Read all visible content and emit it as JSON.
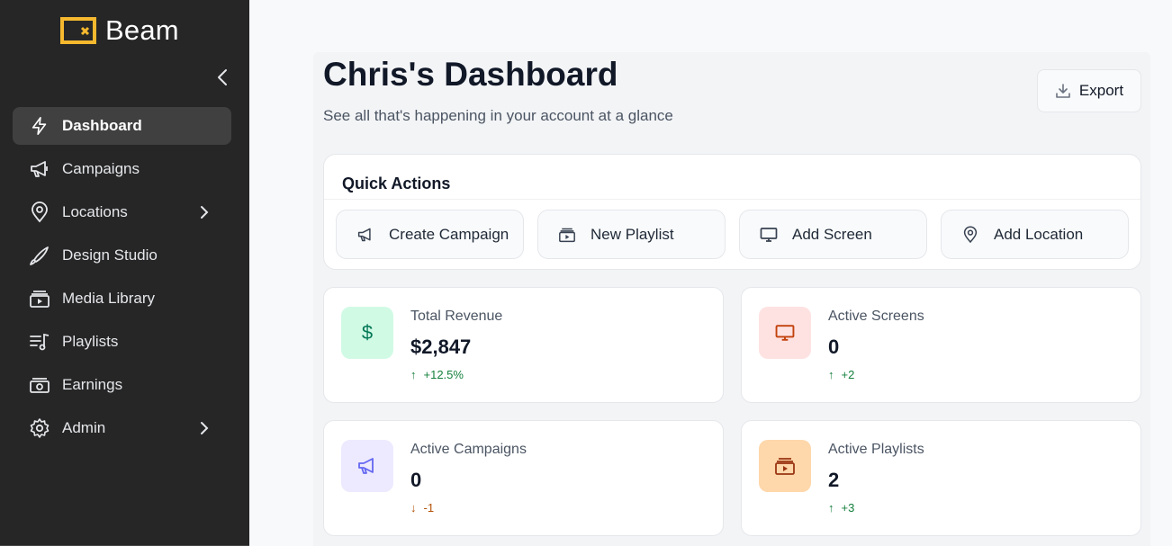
{
  "brand": {
    "name": "Beam",
    "accent": "#f5b82e"
  },
  "sidebar": {
    "items": [
      {
        "label": "Dashboard",
        "icon": "lightning-icon",
        "active": true
      },
      {
        "label": "Campaigns",
        "icon": "megaphone-icon"
      },
      {
        "label": "Locations",
        "icon": "map-pin-icon",
        "has_submenu": true
      },
      {
        "label": "Design Studio",
        "icon": "brush-icon"
      },
      {
        "label": "Media Library",
        "icon": "media-library-icon"
      },
      {
        "label": "Playlists",
        "icon": "playlist-icon"
      },
      {
        "label": "Earnings",
        "icon": "banknote-icon"
      },
      {
        "label": "Admin",
        "icon": "gear-icon",
        "has_submenu": true
      }
    ]
  },
  "header": {
    "title": "Chris's Dashboard",
    "subtitle": "See all that's happening in your account at a glance",
    "export_label": "Export"
  },
  "quick_actions": {
    "title": "Quick Actions",
    "buttons": [
      {
        "label": "Create Campaign",
        "icon": "megaphone-icon"
      },
      {
        "label": "New Playlist",
        "icon": "media-library-icon"
      },
      {
        "label": "Add Screen",
        "icon": "monitor-icon"
      },
      {
        "label": "Add Location",
        "icon": "map-pin-icon"
      }
    ]
  },
  "stats": [
    {
      "label": "Total Revenue",
      "value": "$2,847",
      "change": "+12.5%",
      "direction": "up",
      "icon": "dollar-icon",
      "icon_bg": "#d1fae5",
      "icon_color": "#047857"
    },
    {
      "label": "Active Screens",
      "value": "0",
      "change": "+2",
      "direction": "up",
      "icon": "monitor-icon",
      "icon_bg": "#fee2e2",
      "icon_color": "#c2410c"
    },
    {
      "label": "Active Campaigns",
      "value": "0",
      "change": "-1",
      "direction": "down",
      "icon": "megaphone-icon",
      "icon_bg": "#ede9fe",
      "icon_color": "#6366f1"
    },
    {
      "label": "Active Playlists",
      "value": "2",
      "change": "+3",
      "direction": "up",
      "icon": "media-library-icon",
      "icon_bg": "#fed7aa",
      "icon_color": "#9a3412"
    }
  ],
  "arrows": {
    "up": "↑",
    "down": "↓"
  }
}
